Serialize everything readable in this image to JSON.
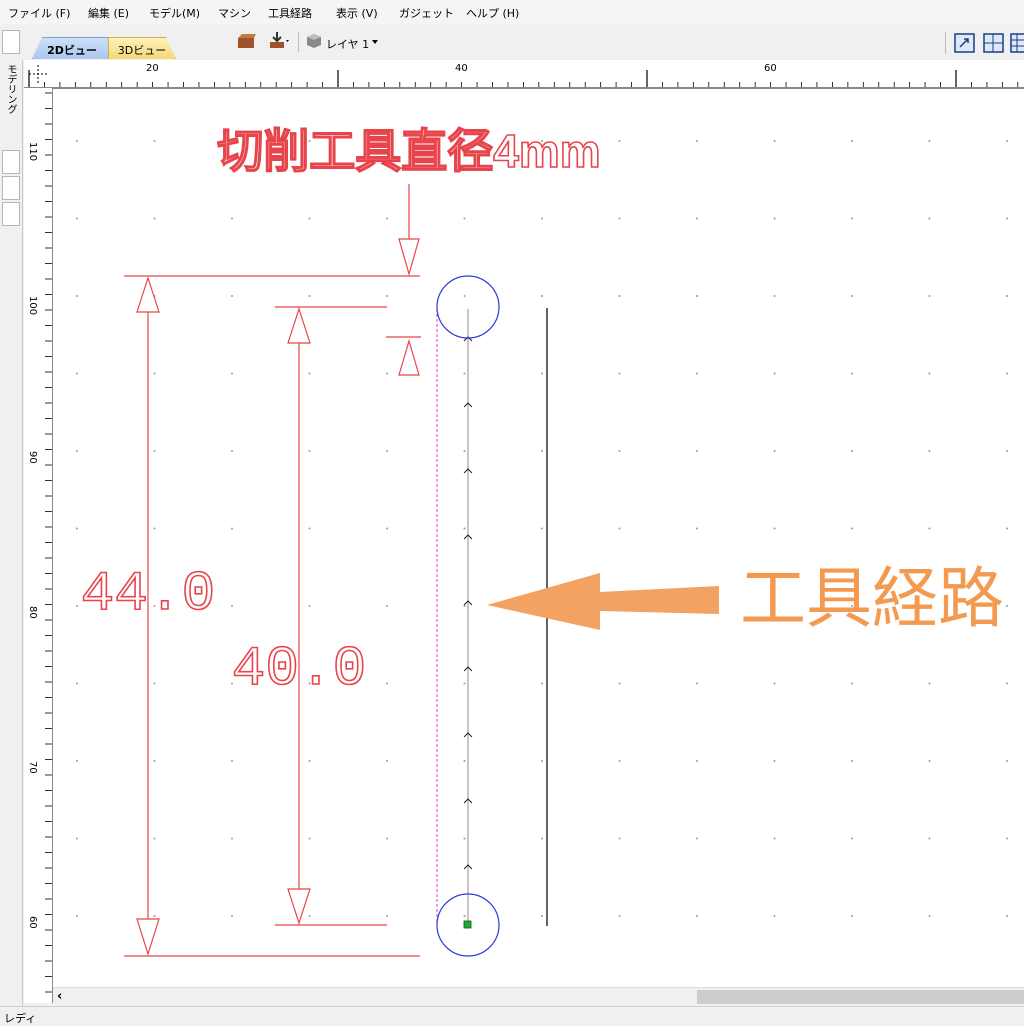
{
  "menu": {
    "items": [
      "ファイル (F)",
      "編集 (E)",
      "モデル(M)",
      "マシン",
      "工具経路",
      "表示 (V)",
      "ガジェット",
      "ヘルプ (H)"
    ]
  },
  "toolbar": {
    "layer_label": "レイヤ 1"
  },
  "tabs": [
    {
      "label": "2Dビュー",
      "active": true
    },
    {
      "label": "3Dビュー",
      "active": false
    }
  ],
  "side_panel": {
    "label": "モデリング"
  },
  "ruler": {
    "horizontal": [
      "20",
      "40",
      "60"
    ],
    "vertical": [
      "110",
      "100",
      "90",
      "80",
      "70",
      "60"
    ]
  },
  "drawing": {
    "tool_diameter_label": "切削工具直径4mm",
    "dim_outer": "44.0",
    "dim_inner": "40.0",
    "toolpath_label": "工具経路"
  },
  "colors": {
    "dimension": "#e8444c",
    "tool_circle": "#2a3bdd",
    "toolpath_label": "#f39a50",
    "arrow": "#f4a261"
  },
  "scrollbar": {
    "left_arrow": "‹"
  },
  "status": {
    "text": "レディ"
  }
}
